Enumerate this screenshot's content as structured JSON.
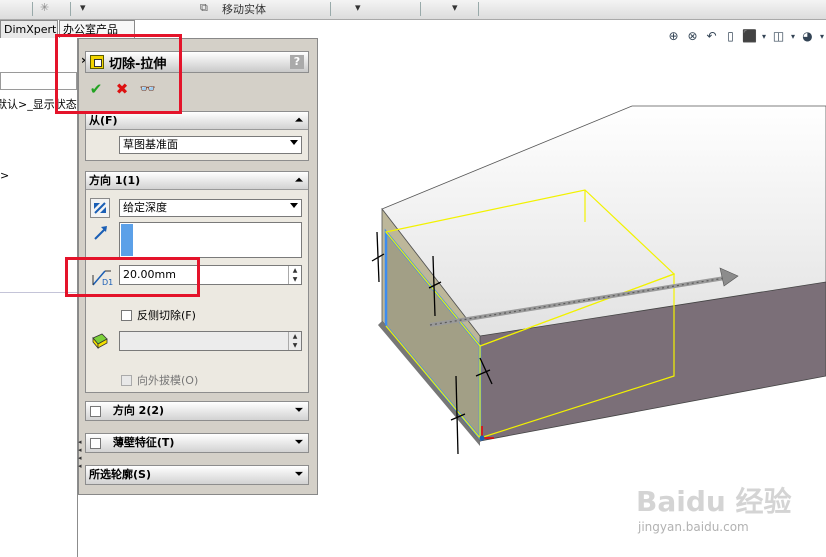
{
  "toolbar": {
    "move_body": "移动实体"
  },
  "tabs": [
    "DimXpert",
    "办公室产品"
  ],
  "left_pane": {
    "line1": "默认>_显示状态",
    "line2": ">",
    "collapse": "»"
  },
  "property_manager": {
    "title": "切除-拉伸",
    "help": "?",
    "from_group": {
      "label": "从(F)",
      "value": "草图基准面"
    },
    "dir1_group": {
      "label": "方向 1(1)",
      "end_condition": "给定深度",
      "depth": "20.00mm",
      "depth_icon_label": "D1",
      "flip_side": "反侧切除(F)",
      "draft_outward": "向外拔模(O)"
    },
    "dir2_group": {
      "label": "方向 2(2)"
    },
    "thin_group": {
      "label": "薄壁特征(T)"
    },
    "contours_group": {
      "label": "所选轮廓(S)"
    }
  },
  "colors": {
    "highlight_box": "#e4132a",
    "face_gray": "#7b6f78",
    "preview_yellow": "#f2f200",
    "accent_blue": "#5ba0e8"
  },
  "watermark": {
    "brand": "Baidu 经验",
    "url": "jingyan.baidu.com"
  }
}
